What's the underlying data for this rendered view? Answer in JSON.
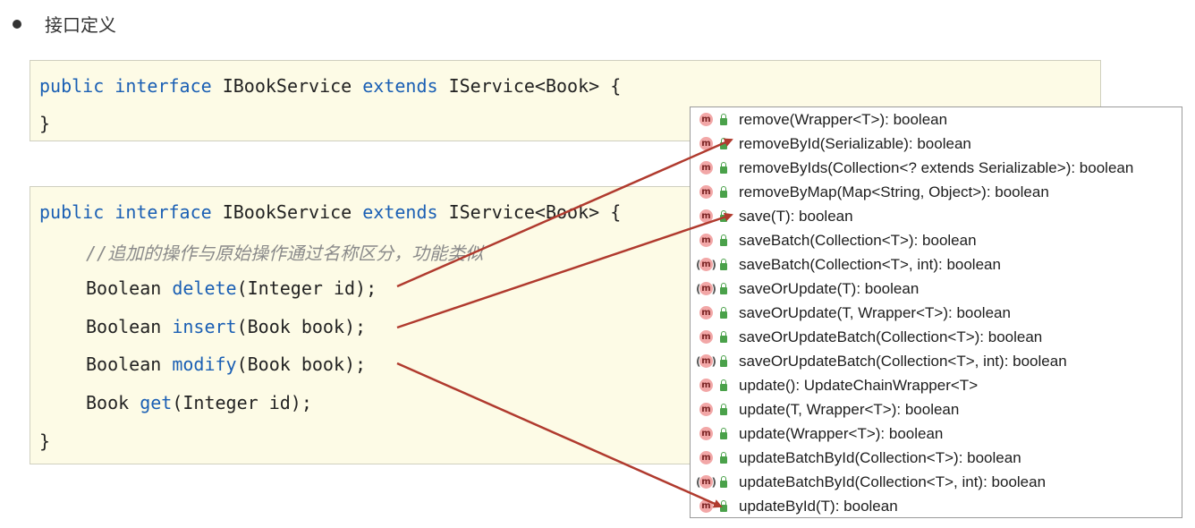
{
  "section": {
    "bullet_text": "接口定义"
  },
  "code1": {
    "line1": {
      "kw1": "public",
      "kw2": "interface",
      "name": " IBookService ",
      "kw3": "extends",
      "rest": " IService<Book> {"
    },
    "line2": "}"
  },
  "code2": {
    "line1": {
      "kw1": "public",
      "kw2": "interface",
      "name": " IBookService ",
      "kw3": "extends",
      "rest": " IService<Book> {"
    },
    "comment": "//追加的操作与原始操作通过名称区分，功能类似",
    "methods": [
      {
        "type": "Boolean ",
        "name": "delete",
        "params": "(Integer id);"
      },
      {
        "type": "Boolean ",
        "name": "insert",
        "params": "(Book book);"
      },
      {
        "type": "Boolean ",
        "name": "modify",
        "params": "(Book book);"
      },
      {
        "type": "Book ",
        "name": "get",
        "params": "(Integer id);"
      }
    ],
    "close": "}"
  },
  "popup": {
    "items": [
      {
        "icon": "m",
        "label": "remove(Wrapper<T>): boolean"
      },
      {
        "icon": "m",
        "label": "removeById(Serializable): boolean"
      },
      {
        "icon": "m",
        "label": "removeByIds(Collection<? extends Serializable>): boolean"
      },
      {
        "icon": "m",
        "label": "removeByMap(Map<String, Object>): boolean"
      },
      {
        "icon": "m",
        "label": "save(T): boolean"
      },
      {
        "icon": "m",
        "label": "saveBatch(Collection<T>): boolean"
      },
      {
        "icon": "m",
        "label": "saveBatch(Collection<T>, int): boolean"
      },
      {
        "icon": "m",
        "label": "saveOrUpdate(T): boolean"
      },
      {
        "icon": "m",
        "label": "saveOrUpdate(T, Wrapper<T>): boolean"
      },
      {
        "icon": "m",
        "label": "saveOrUpdateBatch(Collection<T>): boolean"
      },
      {
        "icon": "m",
        "label": "saveOrUpdateBatch(Collection<T>, int): boolean"
      },
      {
        "icon": "m",
        "label": "update(): UpdateChainWrapper<T>"
      },
      {
        "icon": "m",
        "label": "update(T, Wrapper<T>): boolean"
      },
      {
        "icon": "m",
        "label": "update(Wrapper<T>): boolean"
      },
      {
        "icon": "m",
        "label": "updateBatchById(Collection<T>): boolean"
      },
      {
        "icon": "m",
        "label": "updateBatchById(Collection<T>, int): boolean"
      },
      {
        "icon": "m",
        "label": "updateById(T): boolean"
      }
    ]
  },
  "colors": {
    "keyword": "#1a5fb4",
    "arrow": "#b03a2e",
    "code_bg": "#fdfbe6"
  }
}
